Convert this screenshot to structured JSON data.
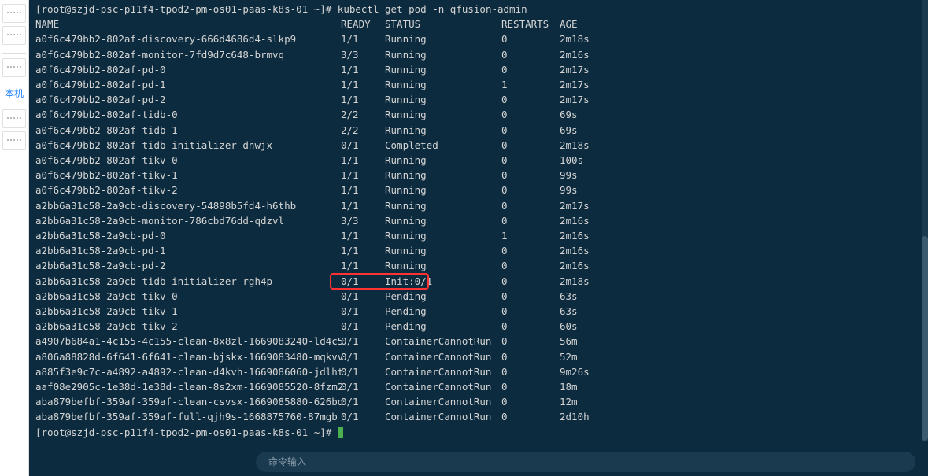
{
  "sidebar": {
    "label": "本机"
  },
  "terminal": {
    "command_prompt_prefix": "[root@szjd-psc-p11f4-tpod2-pm-os01-paas-k8s-01 ~]# ",
    "command": "kubectl get pod -n qfusion-admin",
    "end_prompt": "[root@szjd-psc-p11f4-tpod2-pm-os01-paas-k8s-01 ~]# ",
    "headers": {
      "name": "NAME",
      "ready": "READY",
      "status": "STATUS",
      "restarts": "RESTARTS",
      "age": "AGE"
    },
    "rows": [
      {
        "name": "a0f6c479bb2-802af-discovery-666d4686d4-slkp9",
        "ready": "1/1",
        "status": "Running",
        "restarts": "0",
        "age": "2m18s"
      },
      {
        "name": "a0f6c479bb2-802af-monitor-7fd9d7c648-brmvq",
        "ready": "3/3",
        "status": "Running",
        "restarts": "0",
        "age": "2m16s"
      },
      {
        "name": "a0f6c479bb2-802af-pd-0",
        "ready": "1/1",
        "status": "Running",
        "restarts": "0",
        "age": "2m17s"
      },
      {
        "name": "a0f6c479bb2-802af-pd-1",
        "ready": "1/1",
        "status": "Running",
        "restarts": "1",
        "age": "2m17s"
      },
      {
        "name": "a0f6c479bb2-802af-pd-2",
        "ready": "1/1",
        "status": "Running",
        "restarts": "0",
        "age": "2m17s"
      },
      {
        "name": "a0f6c479bb2-802af-tidb-0",
        "ready": "2/2",
        "status": "Running",
        "restarts": "0",
        "age": "69s"
      },
      {
        "name": "a0f6c479bb2-802af-tidb-1",
        "ready": "2/2",
        "status": "Running",
        "restarts": "0",
        "age": "69s"
      },
      {
        "name": "a0f6c479bb2-802af-tidb-initializer-dnwjx",
        "ready": "0/1",
        "status": "Completed",
        "restarts": "0",
        "age": "2m18s"
      },
      {
        "name": "a0f6c479bb2-802af-tikv-0",
        "ready": "1/1",
        "status": "Running",
        "restarts": "0",
        "age": "100s"
      },
      {
        "name": "a0f6c479bb2-802af-tikv-1",
        "ready": "1/1",
        "status": "Running",
        "restarts": "0",
        "age": "99s"
      },
      {
        "name": "a0f6c479bb2-802af-tikv-2",
        "ready": "1/1",
        "status": "Running",
        "restarts": "0",
        "age": "99s"
      },
      {
        "name": "a2bb6a31c58-2a9cb-discovery-54898b5fd4-h6thb",
        "ready": "1/1",
        "status": "Running",
        "restarts": "0",
        "age": "2m17s"
      },
      {
        "name": "a2bb6a31c58-2a9cb-monitor-786cbd76dd-qdzvl",
        "ready": "3/3",
        "status": "Running",
        "restarts": "0",
        "age": "2m16s"
      },
      {
        "name": "a2bb6a31c58-2a9cb-pd-0",
        "ready": "1/1",
        "status": "Running",
        "restarts": "1",
        "age": "2m16s"
      },
      {
        "name": "a2bb6a31c58-2a9cb-pd-1",
        "ready": "1/1",
        "status": "Running",
        "restarts": "0",
        "age": "2m16s"
      },
      {
        "name": "a2bb6a31c58-2a9cb-pd-2",
        "ready": "1/1",
        "status": "Running",
        "restarts": "0",
        "age": "2m16s"
      },
      {
        "name": "a2bb6a31c58-2a9cb-tidb-initializer-rgh4p",
        "ready": "0/1",
        "status": "Init:0/1",
        "restarts": "0",
        "age": "2m18s"
      },
      {
        "name": "a2bb6a31c58-2a9cb-tikv-0",
        "ready": "0/1",
        "status": "Pending",
        "restarts": "0",
        "age": "63s"
      },
      {
        "name": "a2bb6a31c58-2a9cb-tikv-1",
        "ready": "0/1",
        "status": "Pending",
        "restarts": "0",
        "age": "63s"
      },
      {
        "name": "a2bb6a31c58-2a9cb-tikv-2",
        "ready": "0/1",
        "status": "Pending",
        "restarts": "0",
        "age": "60s"
      },
      {
        "name": "a4907b684a1-4c155-4c155-clean-8x8zl-1669083240-ld4c5",
        "ready": "0/1",
        "status": "ContainerCannotRun",
        "restarts": "0",
        "age": "56m"
      },
      {
        "name": "a806a88828d-6f641-6f641-clean-bjskx-1669083480-mqkvv",
        "ready": "0/1",
        "status": "ContainerCannotRun",
        "restarts": "0",
        "age": "52m"
      },
      {
        "name": "a885f3e9c7c-a4892-a4892-clean-d4kvh-1669086060-jdlht",
        "ready": "0/1",
        "status": "ContainerCannotRun",
        "restarts": "0",
        "age": "9m26s"
      },
      {
        "name": "aaf08e2905c-1e38d-1e38d-clean-8s2xm-1669085520-8fzm2",
        "ready": "0/1",
        "status": "ContainerCannotRun",
        "restarts": "0",
        "age": "18m"
      },
      {
        "name": "aba879befbf-359af-359af-clean-csvsx-1669085880-626bd",
        "ready": "0/1",
        "status": "ContainerCannotRun",
        "restarts": "0",
        "age": "12m"
      },
      {
        "name": "aba879befbf-359af-359af-full-qjh9s-1668875760-87mgb",
        "ready": "0/1",
        "status": "ContainerCannotRun",
        "restarts": "0",
        "age": "2d10h"
      }
    ],
    "input_placeholder": "命令输入"
  },
  "highlight": {
    "row_index": 16
  }
}
